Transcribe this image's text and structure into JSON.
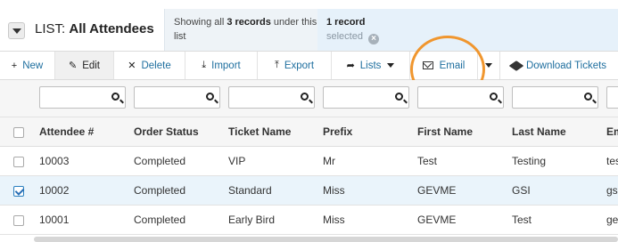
{
  "header": {
    "list_prefix": "LIST:",
    "list_name": "All Attendees",
    "info_prefix": "Showing all ",
    "info_count": "3 records",
    "info_suffix": " under this list",
    "selection_count": "1 record",
    "selection_word": "selected",
    "clear_selection_glyph": "×"
  },
  "toolbar": {
    "new_label": "New",
    "edit_label": "Edit",
    "delete_label": "Delete",
    "import_label": "Import",
    "export_label": "Export",
    "lists_label": "Lists",
    "email_label": "Email",
    "download_tickets_label": "Download Tickets"
  },
  "table": {
    "columns": [
      "Attendee #",
      "Order Status",
      "Ticket Name",
      "Prefix",
      "First Name",
      "Last Name",
      "Em"
    ],
    "rows": [
      {
        "cells": [
          "10003",
          "Completed",
          "VIP",
          "Mr",
          "Test",
          "Testing",
          "tes"
        ],
        "checked": false
      },
      {
        "cells": [
          "10002",
          "Completed",
          "Standard",
          "Miss",
          "GEVME",
          "GSI",
          "gs"
        ],
        "checked": true
      },
      {
        "cells": [
          "10001",
          "Completed",
          "Early Bird",
          "Miss",
          "GEVME",
          "Test",
          "ge"
        ],
        "checked": false
      }
    ]
  },
  "colors": {
    "annotation_circle": "#f0962e",
    "link_blue": "#1f6f9f",
    "selected_row_bg": "#eaf4fb"
  }
}
